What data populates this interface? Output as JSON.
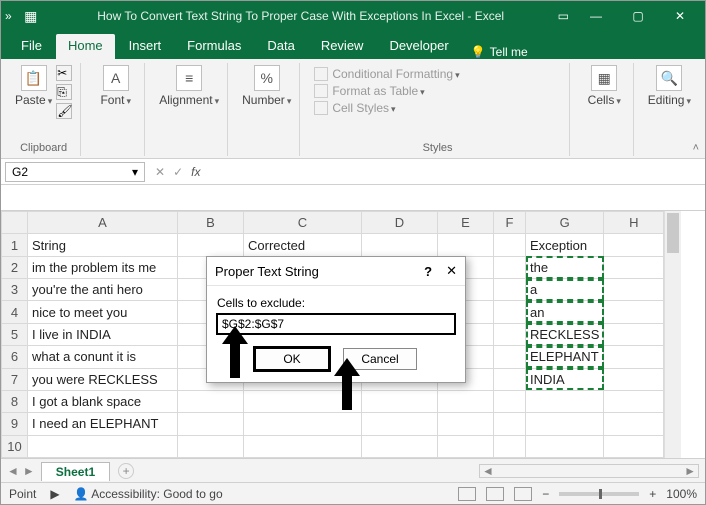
{
  "title": "How To Convert Text String To Proper Case With Exceptions In Excel  -  Excel",
  "tabs": {
    "file": "File",
    "home": "Home",
    "insert": "Insert",
    "formulas": "Formulas",
    "data": "Data",
    "review": "Review",
    "developer": "Developer",
    "tellme": "Tell me"
  },
  "ribbon": {
    "clipboard": {
      "label": "Clipboard",
      "paste": "Paste"
    },
    "font": {
      "btn": "Font",
      "label": ""
    },
    "alignment": {
      "btn": "Alignment"
    },
    "number": {
      "btn": "Number"
    },
    "styles": {
      "label": "Styles",
      "cond": "Conditional Formatting",
      "table": "Format as Table",
      "cell": "Cell Styles"
    },
    "cells": {
      "btn": "Cells"
    },
    "editing": {
      "btn": "Editing"
    }
  },
  "namebox": "G2",
  "columns": [
    "A",
    "B",
    "C",
    "D",
    "E",
    "F",
    "G",
    "H"
  ],
  "rows": [
    {
      "n": "1",
      "A": "String",
      "C": "Corrected",
      "G": "Exception"
    },
    {
      "n": "2",
      "A": "im the problem its me",
      "G": "the"
    },
    {
      "n": "3",
      "A": "you're the anti hero",
      "G": "a"
    },
    {
      "n": "4",
      "A": "nice to meet you",
      "G": "an"
    },
    {
      "n": "5",
      "A": "I live in INDIA",
      "G": "RECKLESS"
    },
    {
      "n": "6",
      "A": "what a conunt it is",
      "G": "ELEPHANT"
    },
    {
      "n": "7",
      "A": "you were RECKLESS",
      "G": "INDIA"
    },
    {
      "n": "8",
      "A": "I got a blank space"
    },
    {
      "n": "9",
      "A": "I need an ELEPHANT"
    },
    {
      "n": "10",
      "A": ""
    }
  ],
  "dialog": {
    "title": "Proper Text String",
    "label": "Cells to exclude:",
    "value": "$G$2:$G$7",
    "ok": "OK",
    "cancel": "Cancel"
  },
  "sheetTab": "Sheet1",
  "status": {
    "mode": "Point",
    "access": "Accessibility: Good to go",
    "zoom": "100%"
  }
}
